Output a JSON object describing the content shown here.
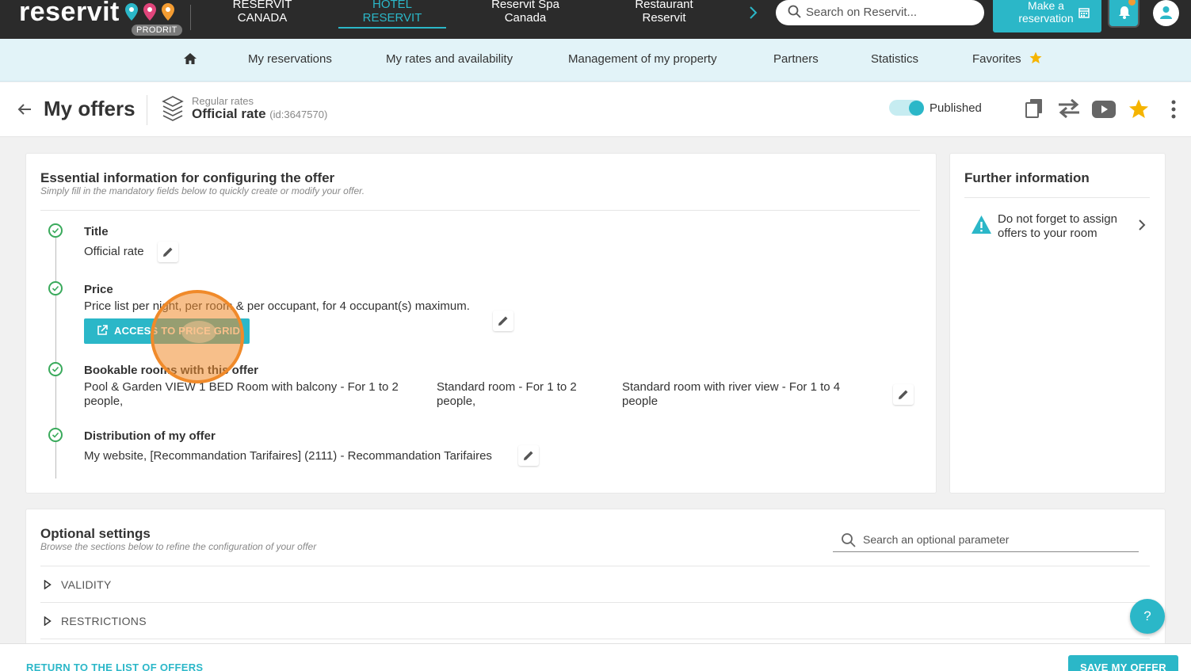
{
  "topbar": {
    "logo_text": "reservit",
    "logo_badge": "PRODRIT",
    "tabs": [
      {
        "label_line1": "RESERVIT",
        "label_line2": "CANADA"
      },
      {
        "label_line1": "HOTEL",
        "label_line2": "RESERVIT"
      },
      {
        "label_line1": "Reservit Spa",
        "label_line2": "Canada"
      },
      {
        "label_line1": "Restaurant",
        "label_line2": "Reservit"
      }
    ],
    "search_placeholder": "Search on Reservit...",
    "reserve_line1": "Make a",
    "reserve_line2": "reservation"
  },
  "subnav": {
    "items": [
      "My reservations",
      "My rates and availability",
      "Management of my property",
      "Partners",
      "Statistics",
      "Favorites"
    ]
  },
  "header": {
    "title": "My offers",
    "rate_category": "Regular rates",
    "rate_name": "Official rate",
    "rate_id": "(id:3647570)",
    "status": "Published"
  },
  "essential": {
    "title": "Essential information for configuring the offer",
    "subtitle": "Simply fill in the mandatory fields below to quickly create or modify your offer.",
    "title_label": "Title",
    "title_value": "Official rate",
    "price_label": "Price",
    "price_value": "Price list per night, per room & per occupant, for 4 occupant(s) maximum.",
    "price_button": "ACCESS TO PRICE GRID",
    "rooms_label": "Bookable rooms with this offer",
    "rooms": [
      {
        "line1": "Pool & Garden VIEW 1 BED Room with balcony - For 1 to 2",
        "line2": "people,"
      },
      {
        "line1": "Standard room - For 1 to 2",
        "line2": "people,"
      },
      {
        "line1": "Standard room with river view - For 1 to 4",
        "line2": "people"
      }
    ],
    "distribution_label": "Distribution of my offer",
    "distribution_value": "My website, [Recommandation Tarifaires] (2111) - Recommandation Tarifaires"
  },
  "further": {
    "title": "Further information",
    "notice_line1": "Do not forget to assign",
    "notice_line2": "offers to your room"
  },
  "optional": {
    "title": "Optional settings",
    "subtitle": "Browse the sections below to refine the configuration of your offer",
    "search_placeholder": "Search an optional parameter",
    "sections": [
      "VALIDITY",
      "RESTRICTIONS"
    ]
  },
  "footer": {
    "return_label": "RETURN TO THE LIST OF OFFERS",
    "save_label": "SAVE MY OFFER"
  },
  "help_label": "?",
  "colors": {
    "accent": "#2bb7c8",
    "topbar": "#2b2b2b",
    "subnav": "#e2f3f8",
    "check": "#3aaa5c",
    "favorite_star": "#f5b400",
    "cursor": "#f08a2a"
  }
}
